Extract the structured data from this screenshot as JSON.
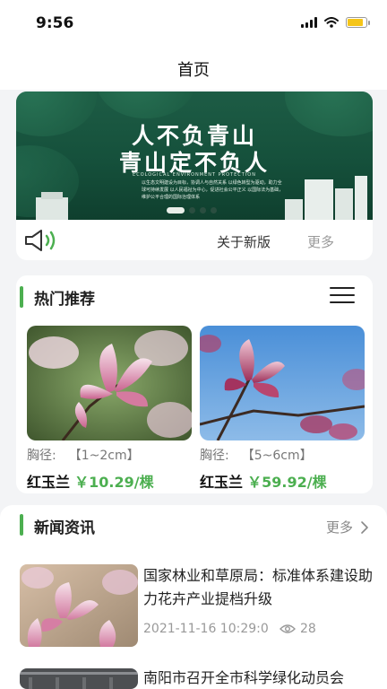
{
  "status": {
    "time": "9:56"
  },
  "nav": {
    "title": "首页"
  },
  "banner": {
    "line1": "人不负青山",
    "line2": "青山定不负人",
    "subtitle": "ECOLOGICAL ENVIRONMENT PROTECTION",
    "paragraph": "以生态文明建设为目标，协调人与自然关系 以绿色转型为驱动，助力全球可持续发展 以人民福祉为中心，促进社会公平正义 以国际法为基础，维护公平合理的国际治理体系",
    "slide_count": 4,
    "active_slide": 1
  },
  "notice": {
    "text": "关于新版",
    "more": "更多"
  },
  "hot": {
    "title": "热门推荐",
    "products": [
      {
        "spec_label": "胸径:",
        "spec_value": "【1~2cm】",
        "name": "红玉兰",
        "price": "￥10.29/棵"
      },
      {
        "spec_label": "胸径:",
        "spec_value": "【5~6cm】",
        "name": "红玉兰",
        "price": "￥59.92/棵"
      }
    ]
  },
  "news": {
    "title": "新闻资讯",
    "more": "更多",
    "items": [
      {
        "title": "国家林业和草原局：标准体系建设助力花卉产业提档升级",
        "date": "2021-11-16 10:29:0",
        "views": "28"
      },
      {
        "title": "南阳市召开全市科学绿化动员会",
        "date": "",
        "views": ""
      }
    ]
  },
  "colors": {
    "accent": "#4caf50",
    "banner_green": "#1d5c45",
    "battery": "#f5c518"
  },
  "icons": [
    "signal-icon",
    "wifi-icon",
    "battery-icon",
    "speaker-icon",
    "list-icon",
    "chevron-right-icon",
    "eye-icon"
  ]
}
